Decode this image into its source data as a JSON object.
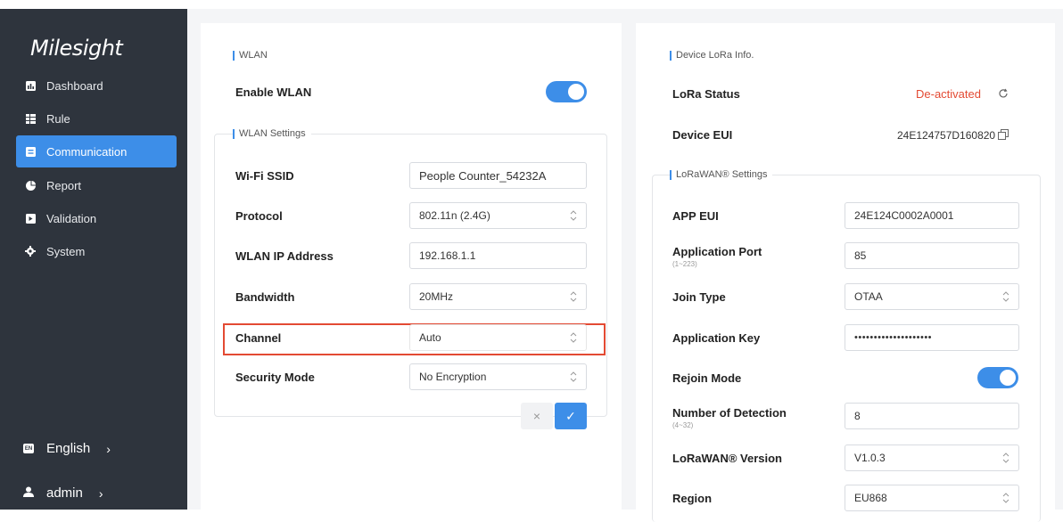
{
  "sidebar": {
    "logo": "Milesight",
    "items": [
      {
        "label": "Dashboard",
        "icon": "bar-chart-icon"
      },
      {
        "label": "Rule",
        "icon": "rule-icon"
      },
      {
        "label": "Communication",
        "icon": "message-icon"
      },
      {
        "label": "Report",
        "icon": "pie-chart-icon"
      },
      {
        "label": "Validation",
        "icon": "validation-icon"
      },
      {
        "label": "System",
        "icon": "gear-icon"
      }
    ],
    "active": "Communication",
    "language": "English",
    "user": "admin"
  },
  "wlan": {
    "section_title": "WLAN",
    "enable_label": "Enable WLAN",
    "enable_on": true,
    "settings_title": "WLAN Settings",
    "ssid_label": "Wi-Fi SSID",
    "ssid_value": "People Counter_54232A",
    "protocol_label": "Protocol",
    "protocol_value": "802.11n (2.4G)",
    "ip_label": "WLAN IP Address",
    "ip_value": "192.168.1.1",
    "bandwidth_label": "Bandwidth",
    "bandwidth_value": "20MHz",
    "channel_label": "Channel",
    "channel_value": "Auto",
    "security_label": "Security Mode",
    "security_value": "No Encryption",
    "cancel_symbol": "×",
    "ok_symbol": "✓"
  },
  "lora": {
    "section_title": "Device LoRa Info.",
    "status_label": "LoRa Status",
    "status_value": "De-activated",
    "eui_label": "Device EUI",
    "eui_value": "24E124757D160820",
    "settings_title": "LoRaWAN® Settings",
    "app_eui_label": "APP EUI",
    "app_eui_value": "24E124C0002A0001",
    "app_port_label": "Application Port",
    "app_port_range": "(1~223)",
    "app_port_value": "85",
    "join_type_label": "Join Type",
    "join_type_value": "OTAA",
    "app_key_label": "Application Key",
    "app_key_value": "••••••••••••••••••••",
    "rejoin_label": "Rejoin Mode",
    "rejoin_on": true,
    "detection_label": "Number of Detection",
    "detection_range": "(4~32)",
    "detection_value": "8",
    "version_label": "LoRaWAN® Version",
    "version_value": "V1.0.3",
    "region_label": "Region",
    "region_value": "EU868"
  },
  "colors": {
    "sidebar_bg": "#2e343d",
    "accent": "#3d8ee8",
    "highlight_box": "#e34a33",
    "status_red": "#e34a33"
  }
}
